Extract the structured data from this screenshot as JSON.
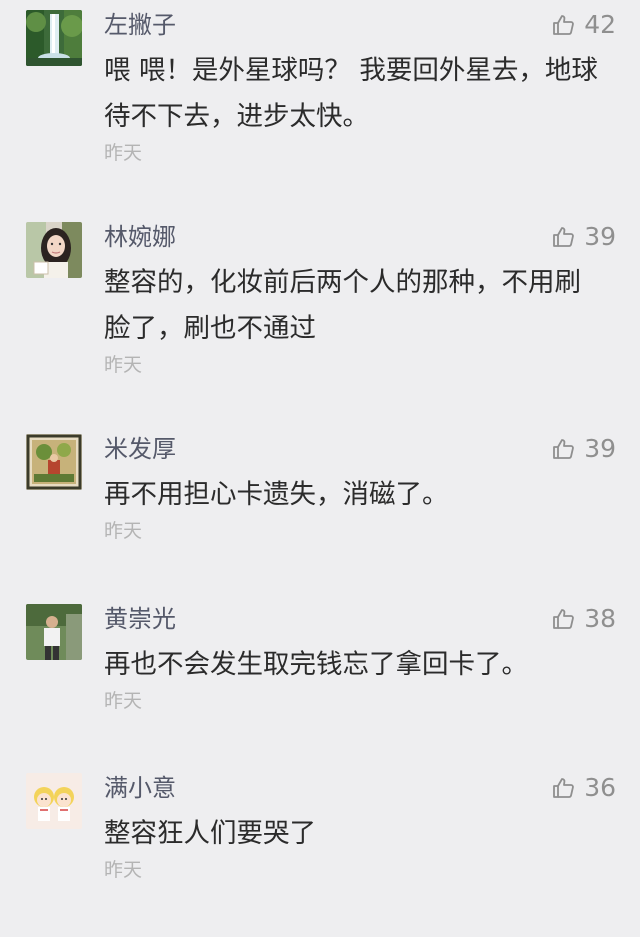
{
  "comments": [
    {
      "author": "左撇子",
      "likes": "42",
      "text": "喂 喂！是外星球吗？ 我要回外星去，地球待不下去，进步太快。",
      "time": "昨天",
      "avatar": "waterfall-avatar"
    },
    {
      "author": "林婉娜",
      "likes": "39",
      "text": "整容的，化妆前后两个人的那种，不用刷脸了，刷也不通过",
      "time": "昨天",
      "avatar": "woman-photo-avatar"
    },
    {
      "author": "米发厚",
      "likes": "39",
      "text": "再不用担心卡遗失，消磁了。",
      "time": "昨天",
      "avatar": "painting-avatar"
    },
    {
      "author": "黄崇光",
      "likes": "38",
      "text": "再也不会发生取完钱忘了拿回卡了。",
      "time": "昨天",
      "avatar": "man-photo-avatar"
    },
    {
      "author": "满小意",
      "likes": "36",
      "text": "整容狂人们要哭了",
      "time": "昨天",
      "avatar": "cartoon-avatar"
    }
  ],
  "colors": {
    "background": "#eeeef0",
    "author_name": "#55596a",
    "comment_text": "#2b2b2b",
    "meta_gray": "#8f8f8f",
    "time_gray": "#b4b4b4"
  },
  "icons": {
    "like": "thumbs-up-icon"
  }
}
